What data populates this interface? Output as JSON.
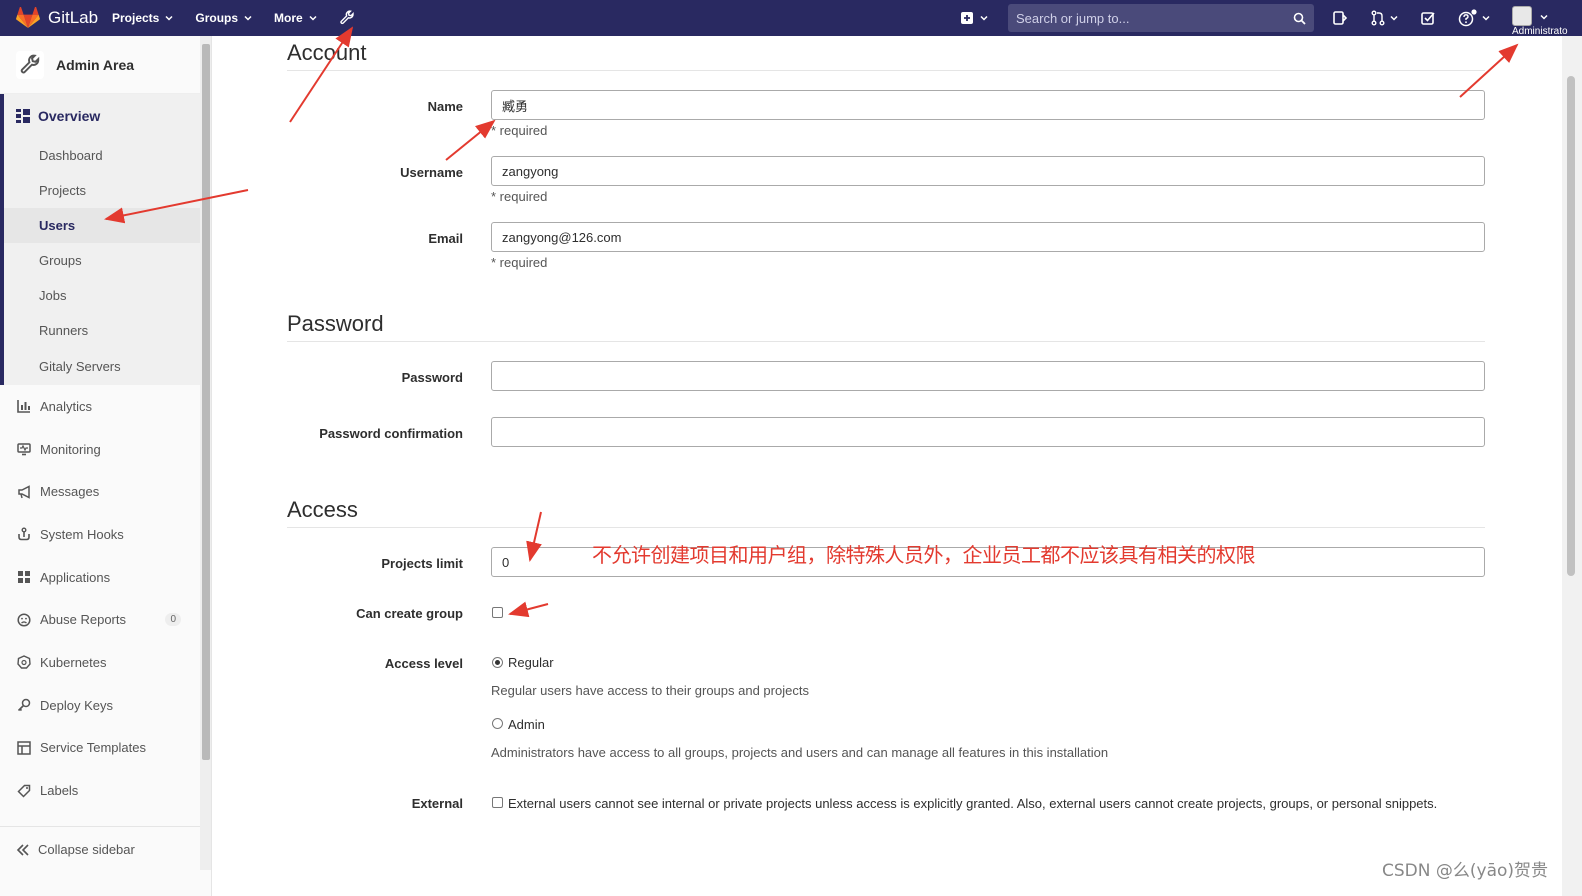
{
  "navbar": {
    "brand": "GitLab",
    "links": [
      {
        "label": "Projects"
      },
      {
        "label": "Groups"
      },
      {
        "label": "More"
      }
    ],
    "search_placeholder": "Search or jump to...",
    "user_label": "Administrato",
    "background": "#292961"
  },
  "sidebar": {
    "context_title": "Admin Area",
    "overview": {
      "label": "Overview",
      "items": [
        {
          "label": "Dashboard"
        },
        {
          "label": "Projects"
        },
        {
          "label": "Users"
        },
        {
          "label": "Groups"
        },
        {
          "label": "Jobs"
        },
        {
          "label": "Runners"
        },
        {
          "label": "Gitaly Servers"
        }
      ],
      "active_item": "Users"
    },
    "items": [
      {
        "label": "Analytics",
        "icon": "analytics-icon"
      },
      {
        "label": "Monitoring",
        "icon": "monitor-icon"
      },
      {
        "label": "Messages",
        "icon": "megaphone-icon"
      },
      {
        "label": "System Hooks",
        "icon": "hook-icon"
      },
      {
        "label": "Applications",
        "icon": "applications-icon"
      },
      {
        "label": "Abuse Reports",
        "icon": "abuse-icon",
        "badge": "0"
      },
      {
        "label": "Kubernetes",
        "icon": "kubernetes-icon"
      },
      {
        "label": "Deploy Keys",
        "icon": "key-icon"
      },
      {
        "label": "Service Templates",
        "icon": "template-icon"
      },
      {
        "label": "Labels",
        "icon": "label-icon"
      }
    ],
    "collapse_label": "Collapse sidebar"
  },
  "form": {
    "account": {
      "title": "Account",
      "name_label": "Name",
      "name_value": "臧勇",
      "username_label": "Username",
      "username_value": "zangyong",
      "email_label": "Email",
      "email_value": "zangyong@126.com",
      "required_text": "* required"
    },
    "password": {
      "title": "Password",
      "password_label": "Password",
      "password_value": "",
      "confirmation_label": "Password confirmation",
      "confirmation_value": ""
    },
    "access": {
      "title": "Access",
      "projects_limit_label": "Projects limit",
      "projects_limit_value": "0",
      "can_create_group_label": "Can create group",
      "can_create_group_checked": false,
      "access_level_label": "Access level",
      "regular_label": "Regular",
      "regular_help": "Regular users have access to their groups and projects",
      "regular_checked": true,
      "admin_label": "Admin",
      "admin_help": "Administrators have access to all groups, projects and users and can manage all features in this installation",
      "admin_checked": false,
      "external_label": "External",
      "external_help": "External users cannot see internal or private projects unless access is explicitly granted. Also, external users cannot create projects, groups, or personal snippets.",
      "external_checked": false
    }
  },
  "annotation": {
    "text": "不允许创建项目和用户组，除特殊人员外，企业员工都不应该具有相关的权限",
    "color": "#e33a2f"
  },
  "watermark": "CSDN @么(yāo)贺贵"
}
